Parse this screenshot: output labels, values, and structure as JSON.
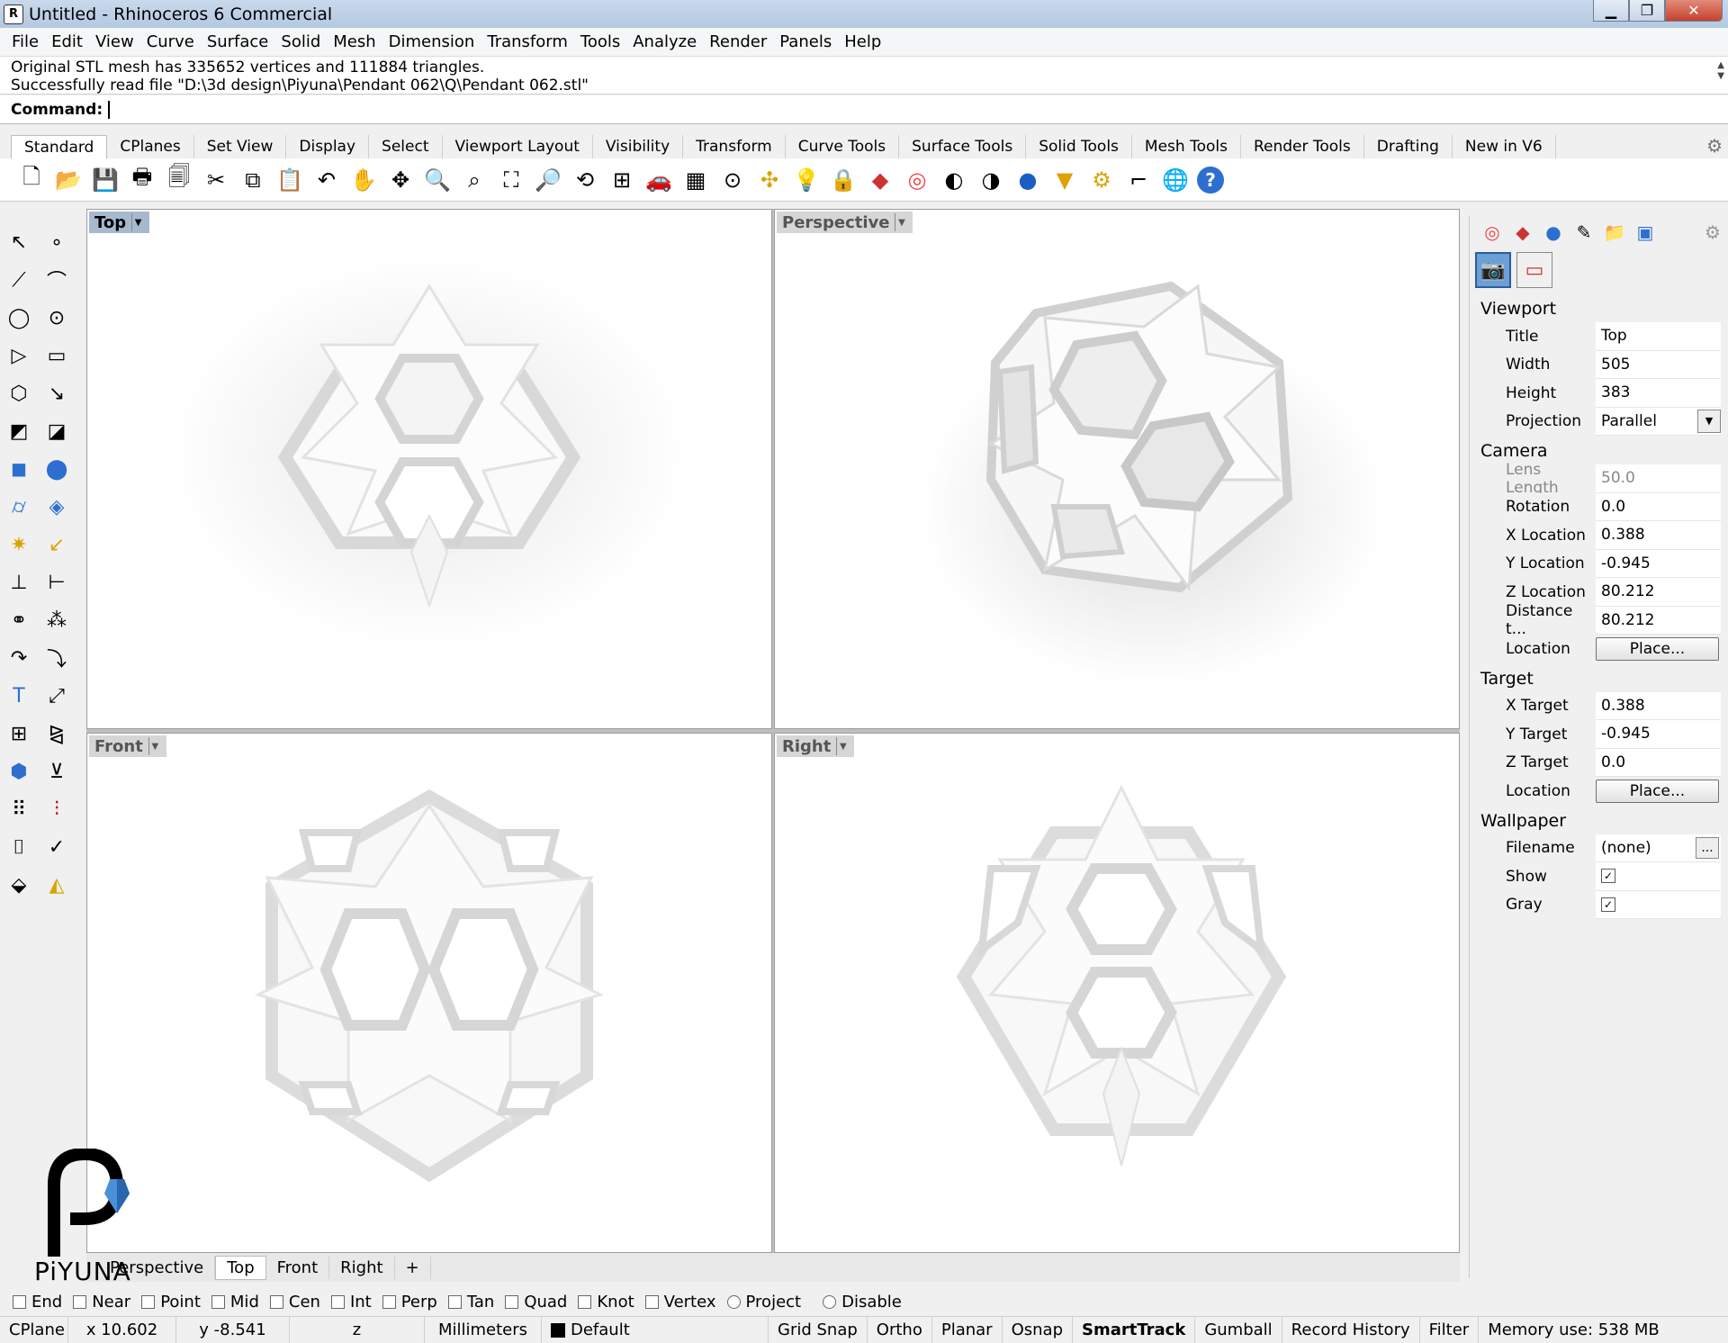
{
  "window": {
    "title": "Untitled - Rhinoceros 6 Commercial",
    "minimize": "▁",
    "maximize": "❐",
    "close": "✕"
  },
  "menu": [
    "File",
    "Edit",
    "View",
    "Curve",
    "Surface",
    "Solid",
    "Mesh",
    "Dimension",
    "Transform",
    "Tools",
    "Analyze",
    "Render",
    "Panels",
    "Help"
  ],
  "command_history": [
    "Original STL mesh has 335652 vertices and 111884 triangles.",
    "Successfully read file \"D:\\3d design\\Piyuna\\Pendant 062\\Q\\Pendant 062.stl\""
  ],
  "command_prompt": "Command:",
  "toolbar_tabs": [
    "Standard",
    "CPlanes",
    "Set View",
    "Display",
    "Select",
    "Viewport Layout",
    "Visibility",
    "Transform",
    "Curve Tools",
    "Surface Tools",
    "Solid Tools",
    "Mesh Tools",
    "Render Tools",
    "Drafting",
    "New in V6"
  ],
  "toolbar_icons": [
    "new-icon",
    "open-icon",
    "save-icon",
    "print-icon",
    "import-icon",
    "cut-icon",
    "copy-icon",
    "paste-icon",
    "undo-icon",
    "pan-icon",
    "rotate-icon",
    "zoom-icon",
    "zoom-window-icon",
    "zoom-extents-icon",
    "zoom-selected-icon",
    "rotate-view-icon",
    "four-viewports-icon",
    "car-icon",
    "grid-icon",
    "target-icon",
    "gumball-icon",
    "light-icon",
    "lock-icon",
    "layer-icon",
    "color-wheel-icon",
    "shaded-sphere-icon",
    "rendered-sphere-icon",
    "material-sphere-icon",
    "spotlight-icon",
    "options-gear-icon",
    "history-icon",
    "render-globe-icon",
    "help-icon"
  ],
  "viewports": {
    "top": "Top",
    "perspective": "Perspective",
    "front": "Front",
    "right": "Right"
  },
  "viewport_tabs": [
    "Perspective",
    "Top",
    "Front",
    "Right",
    "+"
  ],
  "panel": {
    "section_viewport": "Viewport",
    "title_label": "Title",
    "title_value": "Top",
    "width_label": "Width",
    "width_value": "505",
    "height_label": "Height",
    "height_value": "383",
    "projection_label": "Projection",
    "projection_value": "Parallel",
    "section_camera": "Camera",
    "lens_label": "Lens Length",
    "lens_value": "50.0",
    "rotation_label": "Rotation",
    "rotation_value": "0.0",
    "xloc_label": "X Location",
    "xloc_value": "0.388",
    "yloc_label": "Y Location",
    "yloc_value": "-0.945",
    "zloc_label": "Z Location",
    "zloc_value": "80.212",
    "dist_label": "Distance t...",
    "dist_value": "80.212",
    "location_label": "Location",
    "place_button": "Place...",
    "section_target": "Target",
    "xtarget_label": "X Target",
    "xtarget_value": "0.388",
    "ytarget_label": "Y Target",
    "ytarget_value": "-0.945",
    "ztarget_label": "Z Target",
    "ztarget_value": "0.0",
    "tlocation_label": "Location",
    "tplace_button": "Place...",
    "section_wallpaper": "Wallpaper",
    "filename_label": "Filename",
    "filename_value": "(none)",
    "browse_button": "...",
    "show_label": "Show",
    "show_checked": "✓",
    "gray_label": "Gray",
    "gray_checked": "✓"
  },
  "osnap": [
    "End",
    "Near",
    "Point",
    "Mid",
    "Cen",
    "Int",
    "Perp",
    "Tan",
    "Quad",
    "Knot",
    "Vertex",
    "Project"
  ],
  "osnap_disable": "Disable",
  "status": {
    "cplane": "CPlane",
    "x": "x 10.602",
    "y": "y -8.541",
    "z": "z",
    "units": "Millimeters",
    "layer": "Default",
    "grid_snap": "Grid Snap",
    "ortho": "Ortho",
    "planar": "Planar",
    "osnap": "Osnap",
    "smarttrack": "SmartTrack",
    "gumball": "Gumball",
    "record_history": "Record History",
    "filter": "Filter",
    "memory": "Memory use: 538 MB"
  },
  "watermark": "PiYUNA",
  "colors": {
    "accent": "#a7b9cf",
    "selected_button": "#6aa0d6"
  }
}
